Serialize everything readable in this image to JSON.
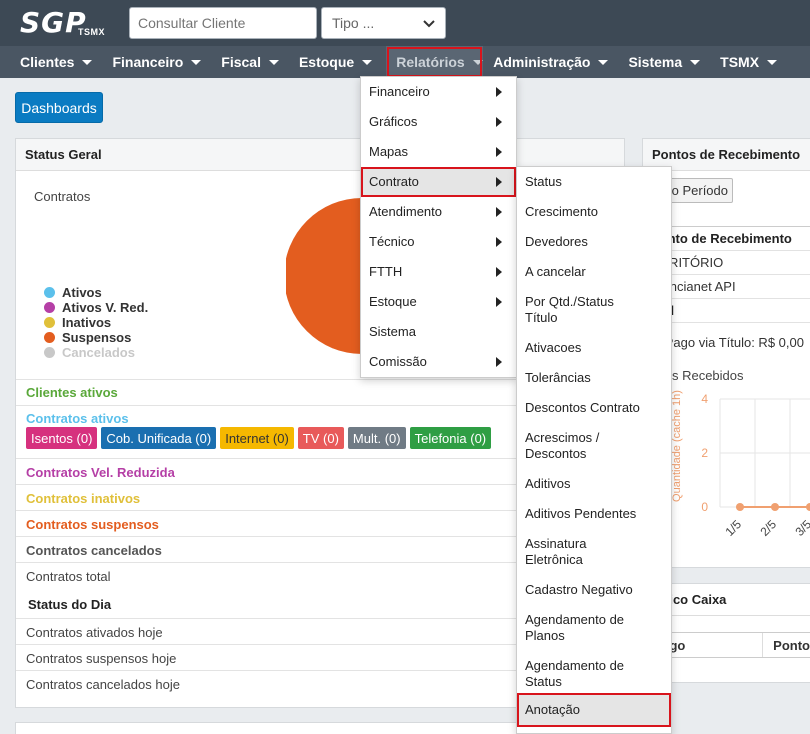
{
  "brand": {
    "logo_main": "SGP",
    "logo_sub": "TSMX"
  },
  "search": {
    "placeholder": "Consultar Cliente"
  },
  "type_select": {
    "value": "Tipo ..."
  },
  "nav": {
    "items": [
      {
        "label": "Clientes"
      },
      {
        "label": "Financeiro"
      },
      {
        "label": "Fiscal"
      },
      {
        "label": "Estoque"
      },
      {
        "label": "Relatórios",
        "active": true
      },
      {
        "label": "Administração"
      },
      {
        "label": "Sistema"
      },
      {
        "label": "TSMX"
      }
    ]
  },
  "dashboards_button": "Dashboards",
  "status_geral": {
    "title": "Status Geral",
    "chart_label": "Contratos",
    "legend": [
      {
        "label": "Ativos",
        "color": "#5bc0eb"
      },
      {
        "label": "Ativos V. Red.",
        "color": "#b53fa6"
      },
      {
        "label": "Inativos",
        "color": "#e0c03a"
      },
      {
        "label": "Suspensos",
        "color": "#e35d1f"
      },
      {
        "label": "Cancelados",
        "color": "#c8c8c8"
      }
    ],
    "clientes_ativos": "Clientes ativos",
    "contratos_ativos": "Contratos ativos",
    "badges": [
      {
        "label": "Isentos (0)",
        "color": "#d6317e"
      },
      {
        "label": "Cob. Unificada (0)",
        "color": "#1a6fb0"
      },
      {
        "label": "Internet (0)",
        "color": "#f5b800"
      },
      {
        "label": "TV (0)",
        "color": "#e85a5a"
      },
      {
        "label": "Mult. (0)",
        "color": "#707b85"
      },
      {
        "label": "Telefonia (0)",
        "color": "#2f9e44"
      }
    ],
    "vel_reduzida": "Contratos Vel. Reduzida",
    "inativos": "Contratos inativos",
    "suspensos": "Contratos suspensos",
    "cancelados": "Contratos cancelados",
    "total": "Contratos total",
    "status_dia": "Status do Dia",
    "ativados_hoje": "Contratos ativados hoje",
    "suspensos_hoje": "Contratos suspensos hoje",
    "cancelados_hoje": "Contratos cancelados hoje"
  },
  "relatorios_menu": [
    {
      "label": "Financeiro",
      "submenu": true
    },
    {
      "label": "Gráficos",
      "submenu": true
    },
    {
      "label": "Mapas",
      "submenu": true
    },
    {
      "label": "Contrato",
      "submenu": true,
      "highlight": true
    },
    {
      "label": "Atendimento",
      "submenu": true
    },
    {
      "label": "Técnico",
      "submenu": true
    },
    {
      "label": "FTTH",
      "submenu": true
    },
    {
      "label": "Estoque",
      "submenu": true
    },
    {
      "label": "Sistema",
      "submenu": false
    },
    {
      "label": "Comissão",
      "submenu": true
    }
  ],
  "contrato_menu": [
    {
      "label": "Status"
    },
    {
      "label": "Crescimento"
    },
    {
      "label": "Devedores"
    },
    {
      "label": "A cancelar"
    },
    {
      "label": "Por Qtd./Status Título"
    },
    {
      "label": "Ativacoes"
    },
    {
      "label": "Tolerâncias"
    },
    {
      "label": "Descontos Contrato"
    },
    {
      "label": "Acrescimos / Descontos"
    },
    {
      "label": "Aditivos"
    },
    {
      "label": "Aditivos Pendentes"
    },
    {
      "label": "Assinatura Eletrônica"
    },
    {
      "label": "Cadastro Negativo"
    },
    {
      "label": "Agendamento de Planos"
    },
    {
      "label": "Agendamento de Status"
    },
    {
      "label": "Anotação",
      "highlight": true
    }
  ],
  "pontos": {
    "title": "Pontos de Recebimento",
    "period_button": "do Período",
    "col_header": "Ponto de Recebimento",
    "rows": [
      "SCRITÓRIO",
      "erencianet API"
    ],
    "total": "otal",
    "total_pago": "al Pago via Título: R$ 0,00",
    "recebidos_title": "tulos Recebidos",
    "ylabel": "Quantidade (cache 1h)"
  },
  "chart_data": {
    "type": "line",
    "categories": [
      "1/5",
      "2/5",
      "3/5"
    ],
    "values": [
      0,
      0,
      0
    ],
    "ylim": [
      0,
      4
    ],
    "yticks": [
      "4",
      "2",
      "0"
    ],
    "ylabel": "Quantidade (cache 1h)"
  },
  "historico": {
    "title": "tórico Caixa",
    "col_codigo": "ódigo",
    "col_ponto": "Ponto"
  }
}
